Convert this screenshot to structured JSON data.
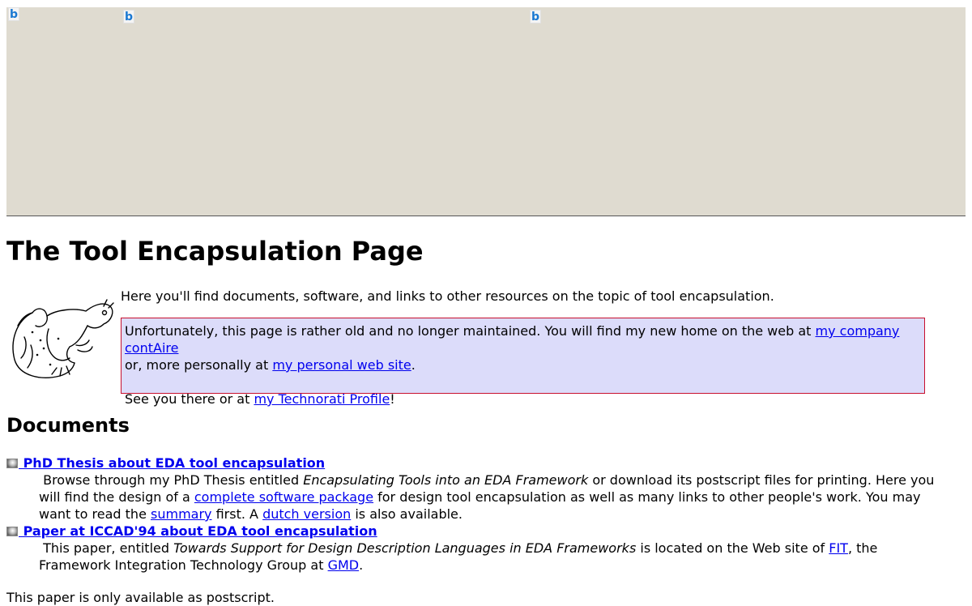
{
  "banner": {
    "icon_glyph": "b"
  },
  "page_title": "The Tool Encapsulation Page",
  "intro": "Here you'll find documents, software, and links to other resources on the topic of tool encapsulation.",
  "notice": {
    "line1_text": "Unfortunately, this page is rather old and no longer maintained. You will find my new home on the web at ",
    "company_link": "my company contAire",
    "line2_prefix": "or, more personally at ",
    "personal_link": "my personal web site",
    "line2_suffix": ".",
    "line3_prefix": "See you there or at ",
    "technorati_link": "my Technorati Profile",
    "line3_suffix": "!"
  },
  "documents": {
    "heading": "Documents",
    "items": [
      {
        "title": " PhD Thesis about EDA tool encapsulation",
        "p1": "Browse through my PhD Thesis entitled ",
        "italic": "Encapsulating Tools into an EDA Framework",
        "p2": " or download its postscript files for printing. Here you will find the design of a ",
        "link1": "complete software package",
        "p3": " for design tool encapsulation as well as many links to other people's work. You may want to read the ",
        "link2": "summary",
        "p4": " first. A ",
        "link3": "dutch version",
        "p5": " is also available."
      },
      {
        "title": " Paper at ICCAD'94 about EDA tool encapsulation",
        "p1": "This paper, entitled ",
        "italic": "Towards Support for Design Description Languages in EDA Frameworks",
        "p2": " is located on the Web site of ",
        "link1": "FIT",
        "p3": ", the Framework Integration Technology Group at ",
        "link2": "GMD",
        "p4": "."
      }
    ],
    "tail": "This paper is only available as postscript."
  },
  "colors": {
    "banner_bg": "#dfdbd0",
    "notice_bg": "#dcdcfa",
    "notice_border": "#c8102e",
    "link": "#0000ee"
  }
}
